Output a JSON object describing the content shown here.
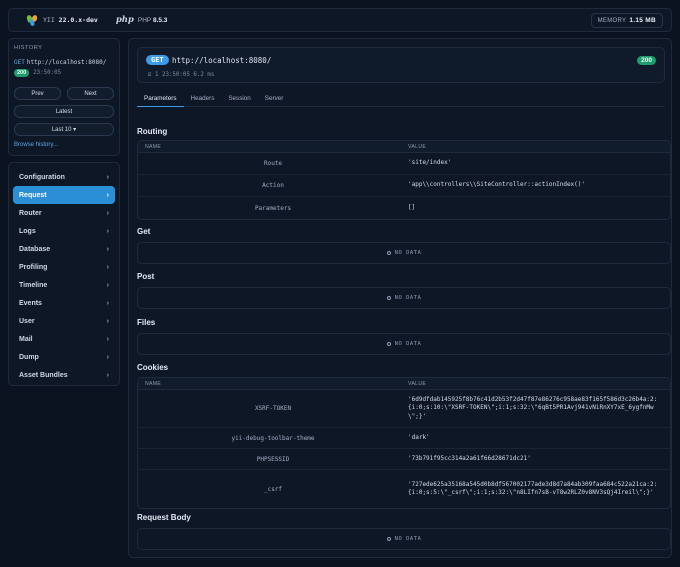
{
  "topbar": {
    "yii_prefix": "YII",
    "yii_version": "22.0.x-dev",
    "php_logo": "php",
    "php_prefix": "PHP",
    "php_version": "8.5.3",
    "memory_label": "MEMORY",
    "memory_value": "1.15 MB"
  },
  "history": {
    "heading": "HISTORY",
    "method": "GET",
    "url": "http://localhost:8080/",
    "status": "200",
    "time": "23:50:05",
    "prev": "Prev",
    "next": "Next",
    "latest": "Latest",
    "last": "Last 10 ▾",
    "browse": "Browse history..."
  },
  "nav": {
    "items": [
      {
        "label": "Configuration"
      },
      {
        "label": "Request"
      },
      {
        "label": "Router"
      },
      {
        "label": "Logs"
      },
      {
        "label": "Database"
      },
      {
        "label": "Profiling"
      },
      {
        "label": "Timeline"
      },
      {
        "label": "Events"
      },
      {
        "label": "User"
      },
      {
        "label": "Mail"
      },
      {
        "label": "Dump"
      },
      {
        "label": "Asset Bundles"
      }
    ],
    "chevron": "›",
    "active_color": "#2b8fd6"
  },
  "request": {
    "method": "GET",
    "url": "http://localhost:8080/",
    "status": "200",
    "meta": "⊡ 1  23:50:05  6.2 ms"
  },
  "tabs": [
    {
      "label": "Parameters"
    },
    {
      "label": "Headers"
    },
    {
      "label": "Session"
    },
    {
      "label": "Server"
    }
  ],
  "sections": {
    "routing": "Routing",
    "get": "Get",
    "post": "Post",
    "files": "Files",
    "cookies": "Cookies",
    "body": "Request Body"
  },
  "columns": {
    "name": "NAME",
    "value": "VALUE"
  },
  "no_data": "NO DATA",
  "routing_rows": [
    {
      "key": "Route",
      "value": "'site/index'"
    },
    {
      "key": "Action",
      "value": "'app\\\\controllers\\\\SiteController::actionIndex()'"
    },
    {
      "key": "Parameters",
      "value": "[]"
    }
  ],
  "cookie_rows": [
    {
      "key": "XSRF-TOKEN",
      "value": "'6d9dfdab145925f8b76c41d2b53f2d47f87e86276c958ae83f165f586d3c26b4a:2:{i:0;s:10:\\\"XSRF-TOKEN\\\";i:1;s:32:\\\"6qBt5PR1Avj941vNiRnXY7xE_6ygfnMw\\\";}'"
    },
    {
      "key": "yii-debug-toolbar-theme",
      "value": "'dark'"
    },
    {
      "key": "PHPSESSID",
      "value": "'73b791f95cc314a2a61f66d28671dc21'"
    },
    {
      "key": "_csrf",
      "value": "'727ede625a35168a545d0b8df567002177ade3d8d7a84ab309faa684c522a21ca:2:{i:0;s:5:\\\"_csrf\\\";i:1;s:32:\\\"n8LIfn7sB-vT8w2RLZ0v8NV3sQj4Ireil\\\";}'"
    }
  ],
  "colors": {
    "accent": "#3d9be9",
    "status_ok": "#1f9d6d",
    "bg": "#0b1320"
  }
}
